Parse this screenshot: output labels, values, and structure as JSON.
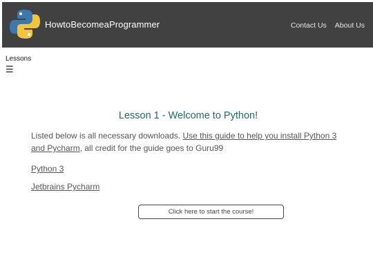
{
  "header": {
    "brand": "HowtoBecomeaProgrammer",
    "logo_icon": "python-logo-icon",
    "nav": [
      {
        "label": "Contact Us"
      },
      {
        "label": "About Us"
      }
    ],
    "colors": {
      "background": "#414141",
      "text": "#ffffff"
    }
  },
  "sidebar": {
    "label": "Lessons",
    "menu_icon": "☰"
  },
  "main": {
    "title": "Lesson 1 - Welcome to Python!",
    "desc_before": "Listed below is all necessary downloads. ",
    "guide_link": "Use this guide to help you install Python 3 and Pycharm",
    "desc_after": ", all credit for the guide goes to Guru99",
    "links": [
      {
        "label": "Python 3"
      },
      {
        "label": "Jetbrains Pycharm"
      }
    ],
    "start_button": "Click here to start the course!",
    "colors": {
      "title": "#1f6b5b"
    }
  }
}
